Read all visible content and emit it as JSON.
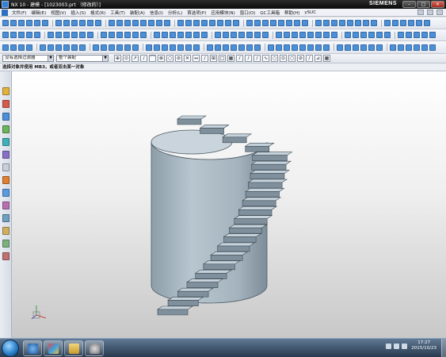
{
  "window": {
    "title": "NX 10 - 建模 - [1023003.prt （修改的）]",
    "brand": "SIEMENS",
    "buttons": {
      "minimize": "–",
      "maximize": "□",
      "close": "×"
    }
  },
  "menubar": {
    "items": [
      "文件(F)",
      "编辑(E)",
      "视图(V)",
      "插入(S)",
      "格式(R)",
      "工具(T)",
      "装配(A)",
      "信息(I)",
      "分析(L)",
      "首选项(P)",
      "应用模块(N)",
      "窗口(O)",
      "GC工具箱",
      "帮助(H)",
      "ySUC"
    ]
  },
  "filterbar": {
    "type_filter": "没有选择过滤器",
    "scope": "整个装配"
  },
  "cue": "选择对象并使用 MB3，或者双击某一对象",
  "taskbar": {
    "time": "17:27",
    "date": "2015/10/23"
  },
  "colors": {
    "model_face": "#a8b6c0",
    "model_dark": "#5e6f7b",
    "model_light": "#c6d2db",
    "title_bg": "#111111",
    "accent": "#2f6fbf"
  }
}
